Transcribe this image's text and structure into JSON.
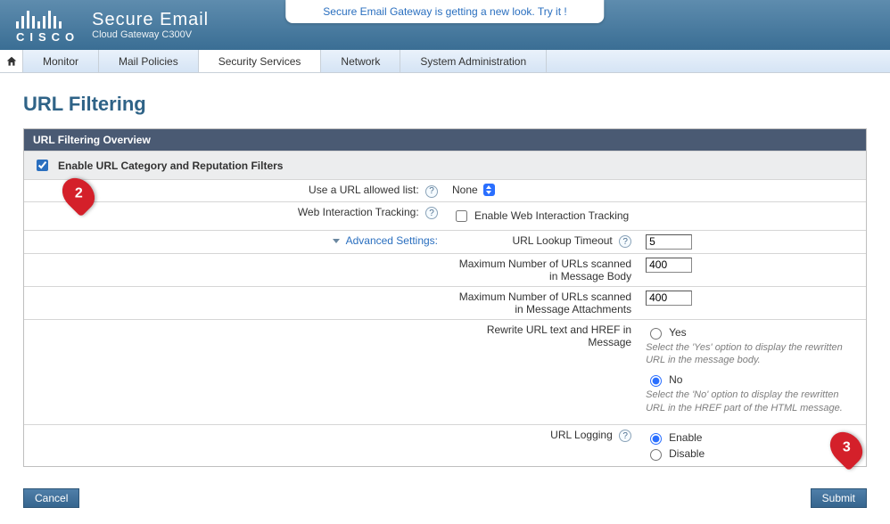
{
  "banner": {
    "text": "Secure Email Gateway is getting a new look. Try it !"
  },
  "brand": {
    "name": "Secure Email",
    "sub": "Cloud Gateway C300V",
    "vendor": "CISCO"
  },
  "nav": {
    "items": [
      {
        "label": "Monitor"
      },
      {
        "label": "Mail Policies"
      },
      {
        "label": "Security Services",
        "active": true
      },
      {
        "label": "Network"
      },
      {
        "label": "System Administration"
      }
    ]
  },
  "page": {
    "title": "URL Filtering"
  },
  "panel": {
    "title": "URL Filtering Overview",
    "enable_label": "Enable URL Category and Reputation Filters",
    "enable_checked": true
  },
  "rows": {
    "allowed_list": {
      "label": "Use a URL allowed list:",
      "value": "None"
    },
    "web_tracking": {
      "label": "Web Interaction Tracking:",
      "checkbox_label": "Enable Web Interaction Tracking",
      "checked": false
    },
    "advanced_link": "Advanced Settings:",
    "lookup": {
      "label": "URL Lookup Timeout",
      "value": "5"
    },
    "max_body": {
      "label": "Maximum Number of URLs scanned in Message Body",
      "value": "400"
    },
    "max_att": {
      "label": "Maximum Number of URLs scanned in Message Attachments",
      "value": "400"
    },
    "rewrite": {
      "label": "Rewrite URL text and HREF in Message",
      "yes": "Yes",
      "yes_hint": "Select the 'Yes' option to display the rewritten URL in the message body.",
      "no": "No",
      "no_hint": "Select the 'No' option to display the rewritten URL in the HREF part of the HTML message.",
      "selected": "no"
    },
    "logging": {
      "label": "URL Logging",
      "enable": "Enable",
      "disable": "Disable",
      "selected": "enable"
    }
  },
  "buttons": {
    "cancel": "Cancel",
    "submit": "Submit"
  },
  "callouts": {
    "c2": "2",
    "c3": "3"
  }
}
